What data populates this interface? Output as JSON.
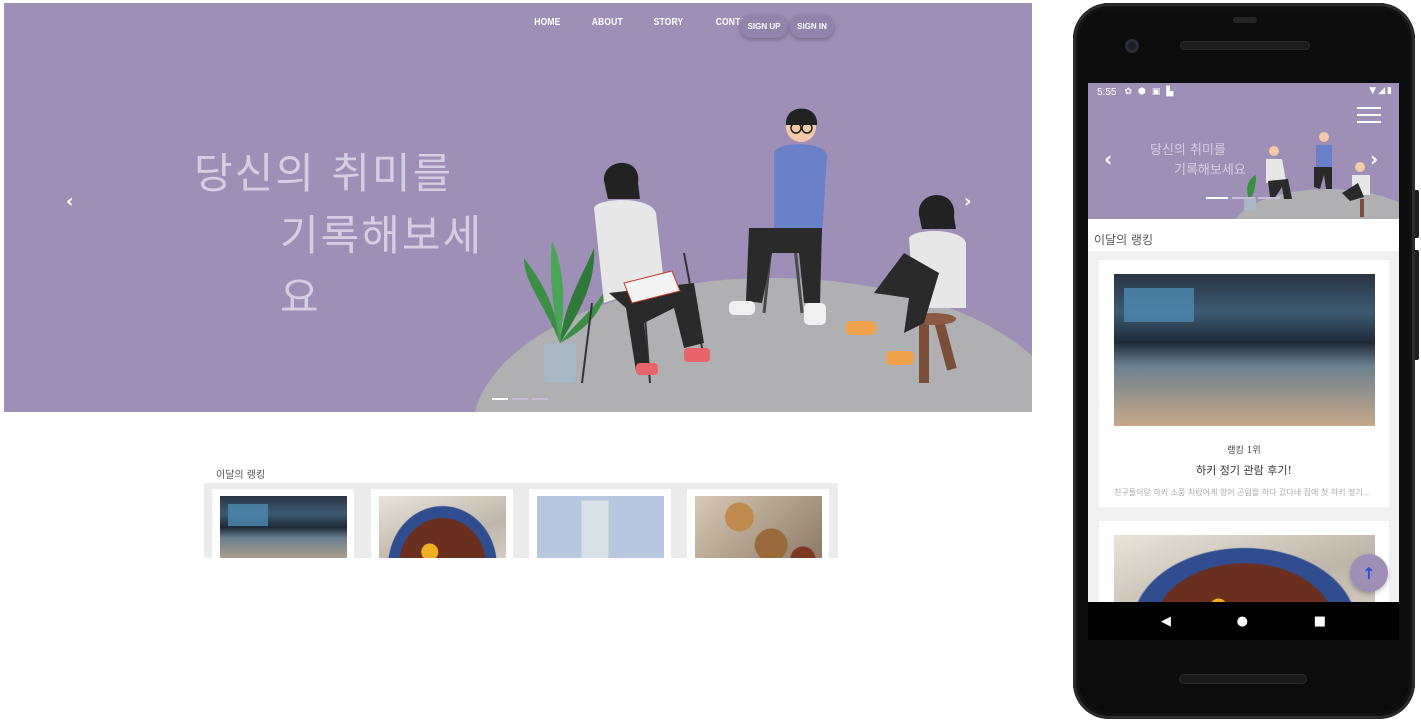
{
  "desktop": {
    "nav": [
      "HOME",
      "ABOUT",
      "STORY",
      "CONTACT"
    ],
    "signup_label": "SIGN UP",
    "signin_label": "SIGN IN",
    "slogan_line1": "당신의 취미를",
    "slogan_line2": "기록해보세요",
    "prev_arrow": "‹",
    "next_arrow": "›",
    "ranking_title": "이달의 랭킹",
    "carousel_active_slide": 1,
    "carousel_slides": 3,
    "ranking_cards": [
      {
        "image": "hockey-arena"
      },
      {
        "image": "steak-bowl"
      },
      {
        "image": "book-cover"
      },
      {
        "image": "burger-plate"
      }
    ]
  },
  "mobile": {
    "status_time": "5:55",
    "status_icons": [
      "gear-icon",
      "shield-icon",
      "image-icon",
      "sd-card-icon"
    ],
    "status_right_icons": [
      "wifi-icon",
      "signal-icon",
      "battery-icon"
    ],
    "slogan_line1": "당신의 취미를",
    "slogan_line2": "기록해보세요",
    "prev_arrow": "‹",
    "next_arrow": "›",
    "ranking_title": "이달의 랭킹",
    "cards": [
      {
        "rank": "랭킹 1위",
        "title": "하키 정기 관람 후기!",
        "desc": "친구들이랑 하키 소풍 치렀어게 양어 곤림을 하다 갔다네 집에 첫 하키 정기..."
      }
    ],
    "fab_icon": "↑",
    "nav_buttons": [
      "◀",
      "●",
      "■"
    ]
  },
  "colors": {
    "hero_purple": "#9e8fb6",
    "slogan_lavender": "#d5cde3",
    "hill_gray": "#b0b0b3"
  }
}
